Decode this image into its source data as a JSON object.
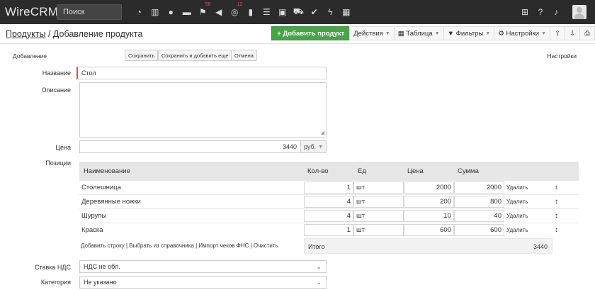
{
  "navbar": {
    "brand": "WireCRM",
    "search_placeholder": "Поиск",
    "icons": [
      {
        "name": "dashboard-icon",
        "glyph": "◔"
      },
      {
        "name": "building-icon",
        "glyph": "▥"
      },
      {
        "name": "user-icon",
        "glyph": "●"
      },
      {
        "name": "briefcase-icon",
        "glyph": "▬"
      },
      {
        "name": "flag-icon",
        "glyph": "⚑",
        "badge": "58"
      },
      {
        "name": "bullhorn-icon",
        "glyph": "◀"
      },
      {
        "name": "lifebuoy-icon",
        "glyph": "◎",
        "badge": "12"
      },
      {
        "name": "barcode-icon",
        "glyph": "▮"
      },
      {
        "name": "list-icon",
        "glyph": "☰"
      },
      {
        "name": "money-icon",
        "glyph": "▣"
      },
      {
        "name": "cart-icon",
        "glyph": "⛟"
      },
      {
        "name": "check-icon",
        "glyph": "✔"
      },
      {
        "name": "bolt-icon",
        "glyph": "ϟ"
      },
      {
        "name": "grid-icon",
        "glyph": "▦"
      }
    ],
    "right_icons": [
      {
        "name": "plus-square-icon",
        "glyph": "⊞"
      },
      {
        "name": "question-icon",
        "glyph": "?"
      },
      {
        "name": "bell-icon",
        "glyph": "♪"
      }
    ]
  },
  "breadcrumb": {
    "parent": "Продукты",
    "separator": " / ",
    "current": "Добавление продукта"
  },
  "toolbar": {
    "add_product": "+ Добавить продукт",
    "actions": "Действия",
    "table": "▦ Таблица",
    "filters": "▼ Фильтры",
    "settings": "⚙ Настройки",
    "upload_glyph": "⇧",
    "download_glyph": "⇩",
    "print_glyph": "⎙"
  },
  "form": {
    "title": "Добавление",
    "save": "Сохранить",
    "save_and_add": "Сохранить и добавить еще",
    "cancel": "Отмена",
    "settings": "Настройки",
    "name_label": "Название",
    "name_value": "Стол",
    "description_label": "Описание",
    "description_value": "",
    "price_label": "Цена",
    "price_value": "3440",
    "currency": "руб.",
    "positions_label": "Позиции",
    "vat_label": "Ставка НДС",
    "vat_value": "НДС не обл.",
    "category_label": "Категория",
    "category_value": "Не указано"
  },
  "positions": {
    "headers": [
      "Наименование",
      "Кол-во",
      "Ед",
      "Цена",
      "Сумма"
    ],
    "rows": [
      {
        "name": "Столешница",
        "qty": "1",
        "unit": "шт",
        "price": "2000",
        "sum": "2000"
      },
      {
        "name": "Деревянные ножки",
        "qty": "4",
        "unit": "шт",
        "price": "200",
        "sum": "800"
      },
      {
        "name": "Шурупы",
        "qty": "4",
        "unit": "шт",
        "price": "10",
        "sum": "40"
      },
      {
        "name": "Краска",
        "qty": "1",
        "unit": "шт",
        "price": "600",
        "sum": "600"
      }
    ],
    "delete_label": "Удалить",
    "drag_glyph": "↕",
    "footer_links": "Добавить строку | Выбрать из справочника | Импорт чеков ФНС | Очистить",
    "total_label": "Итого",
    "total_value": "3440"
  }
}
